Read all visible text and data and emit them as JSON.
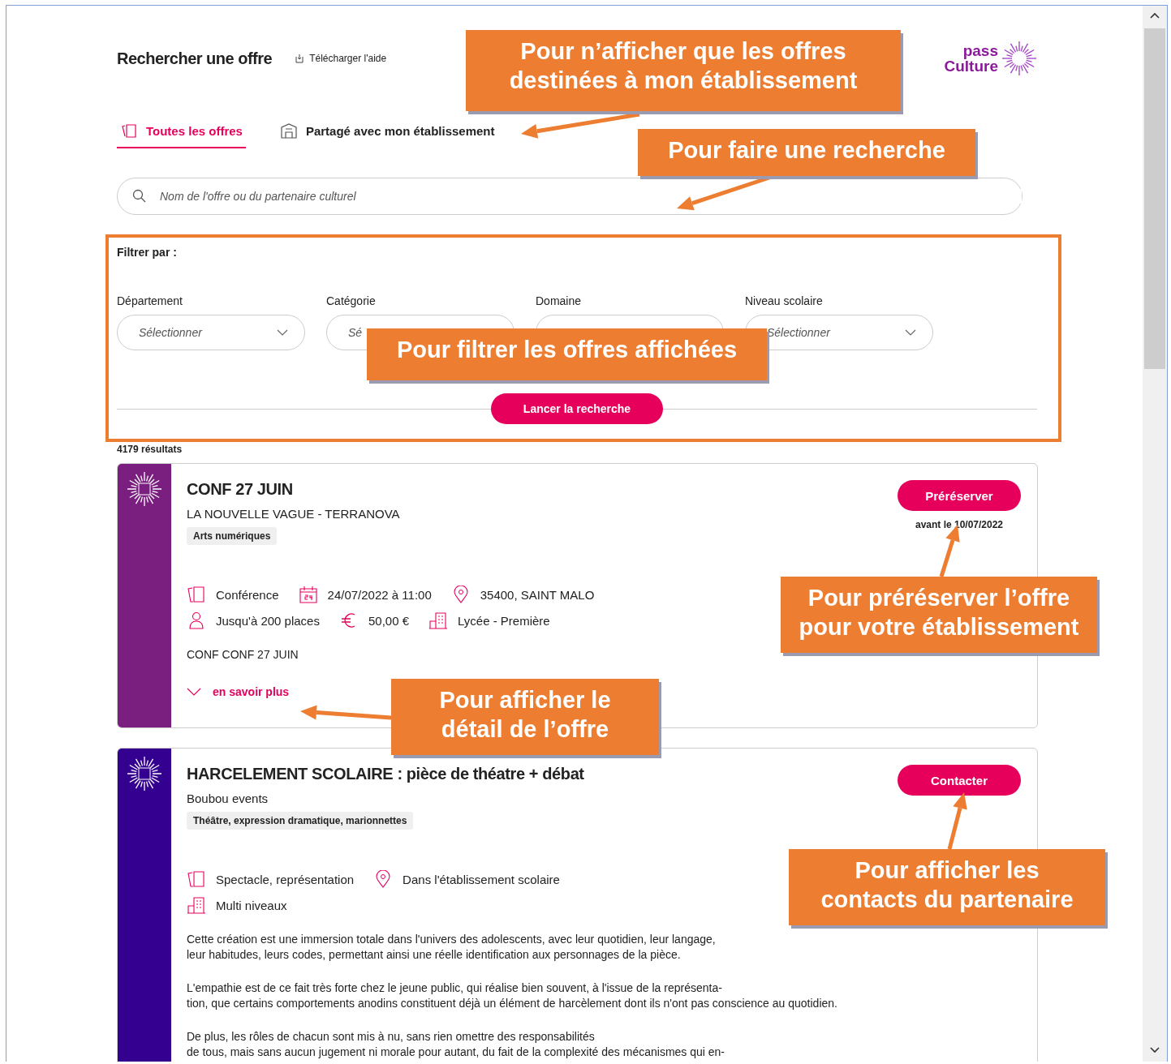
{
  "header": {
    "title": "Rechercher une offre",
    "help_link": "Télécharger l'aide"
  },
  "logo": {
    "line_1": "pass",
    "line_2": "Culture"
  },
  "tabs": [
    {
      "label": "Toutes les offres",
      "selected": true,
      "kind": "all"
    },
    {
      "label": "Partagé avec mon établissement",
      "selected": false,
      "kind": "school"
    }
  ],
  "search": {
    "placeholder": "Nom de l'offre ou du partenaire culturel"
  },
  "filters": {
    "title": "Filtrer par :",
    "dropdowns": [
      {
        "label": "Département",
        "placeholder": "Sélectionner"
      },
      {
        "label": "Catégorie",
        "placeholder": "Sé"
      },
      {
        "label": "Domaine"
      },
      {
        "label": "Niveau scolaire",
        "placeholder": "Sélectionner"
      }
    ],
    "submit": "Lancer la recherche"
  },
  "results_count": "4179 résultats",
  "offers": [
    {
      "color": "#7a1e80",
      "title": "CONF 27 JUIN",
      "partner": "LA NOUVELLE VAGUE - TERRANOVA",
      "tag": "Arts numériques",
      "details": [
        [
          {
            "kind": "category",
            "text": "Conférence"
          },
          {
            "kind": "date",
            "text": "24/07/2022 à 11:00"
          },
          {
            "kind": "location",
            "text": "35400, SAINT MALO"
          }
        ],
        [
          {
            "kind": "people",
            "text": "Jusqu'à 200 places"
          },
          {
            "kind": "price",
            "text": "50,00 €"
          },
          {
            "kind": "level",
            "text": "Lycée - Première"
          }
        ]
      ],
      "description": [
        [
          "CONF CONF 27 JUIN"
        ]
      ],
      "more_link": "en savoir plus",
      "button": "Préréserver",
      "button_note": "avant le 10/07/2022"
    },
    {
      "color": "#33008f",
      "title": "HARCELEMENT SCOLAIRE : pièce de théatre + débat",
      "partner": "Boubou events",
      "tag": "Théâtre, expression dramatique, marionnettes",
      "details": [
        [
          {
            "kind": "category",
            "text": "Spectacle, représentation"
          },
          {
            "kind": "location",
            "text": "Dans l'établissement scolaire"
          }
        ],
        [
          {
            "kind": "level",
            "text": "Multi niveaux"
          }
        ]
      ],
      "description": [
        [
          "Cette création est une immersion totale dans l'univers des adolescents, avec leur quotidien, leur langage,",
          "leur habitudes, leurs codes, permettant ainsi une réelle identification aux personnages de la pièce."
        ],
        [
          "L'empathie est de ce fait très forte chez le jeune public, qui réalise bien souvent, à l'issue de la représenta-",
          "tion, que certains comportements anodins constituent déjà un élément de harcèlement dont ils n'ont pas conscience au quotidien."
        ],
        [
          "De plus, les rôles de chacun sont mis à nu, sans rien omettre des responsabilités",
          "de tous, mais sans aucun jugement ni morale pour autant, du fait de la complexité des mécanismes qui en-"
        ]
      ],
      "button": "Contacter"
    }
  ],
  "annotations": [
    {
      "lines": [
        "Pour n’afficher que les offres",
        "destinées à mon établissement"
      ]
    },
    {
      "lines": [
        "Pour faire une recherche"
      ]
    },
    {
      "lines": [
        "Pour filtrer les offres affichées"
      ]
    },
    {
      "lines": [
        "Pour préréserver l’offre",
        "pour votre établissement"
      ]
    },
    {
      "lines": [
        "Pour afficher le",
        "détail de l’offre"
      ]
    },
    {
      "lines": [
        "Pour afficher les",
        "contacts du partenaire"
      ]
    }
  ]
}
